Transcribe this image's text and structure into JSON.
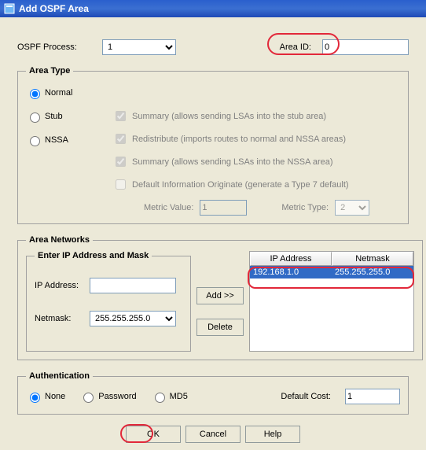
{
  "titlebar": {
    "title": "Add OSPF Area"
  },
  "top": {
    "ospf_process_label": "OSPF Process:",
    "ospf_process_value": "1",
    "area_id_label": "Area ID:",
    "area_id_value": "0"
  },
  "area_type": {
    "legend": "Area Type",
    "normal": "Normal",
    "stub": "Stub",
    "nssa": "NSSA",
    "summary_stub": "Summary (allows sending LSAs into the stub area)",
    "redistribute": "Redistribute (imports routes to normal and NSSA areas)",
    "summary_nssa": "Summary (allows sending LSAs into the NSSA area)",
    "default_info": "Default Information Originate (generate a Type 7 default)",
    "metric_value_label": "Metric Value:",
    "metric_value": "1",
    "metric_type_label": "Metric Type:",
    "metric_type": "2"
  },
  "area_networks": {
    "legend": "Area Networks",
    "inner_legend": "Enter IP Address and Mask",
    "ip_label": "IP Address:",
    "ip_value": "",
    "netmask_label": "Netmask:",
    "netmask_value": "255.255.255.0",
    "add_btn": "Add >>",
    "delete_btn": "Delete",
    "col_ip": "IP Address",
    "col_mask": "Netmask",
    "row_ip": "192.168.1.0",
    "row_mask": "255.255.255.0"
  },
  "auth": {
    "legend": "Authentication",
    "none": "None",
    "password": "Password",
    "md5": "MD5",
    "default_cost_label": "Default Cost:",
    "default_cost_value": "1"
  },
  "footer": {
    "ok": "OK",
    "cancel": "Cancel",
    "help": "Help"
  }
}
